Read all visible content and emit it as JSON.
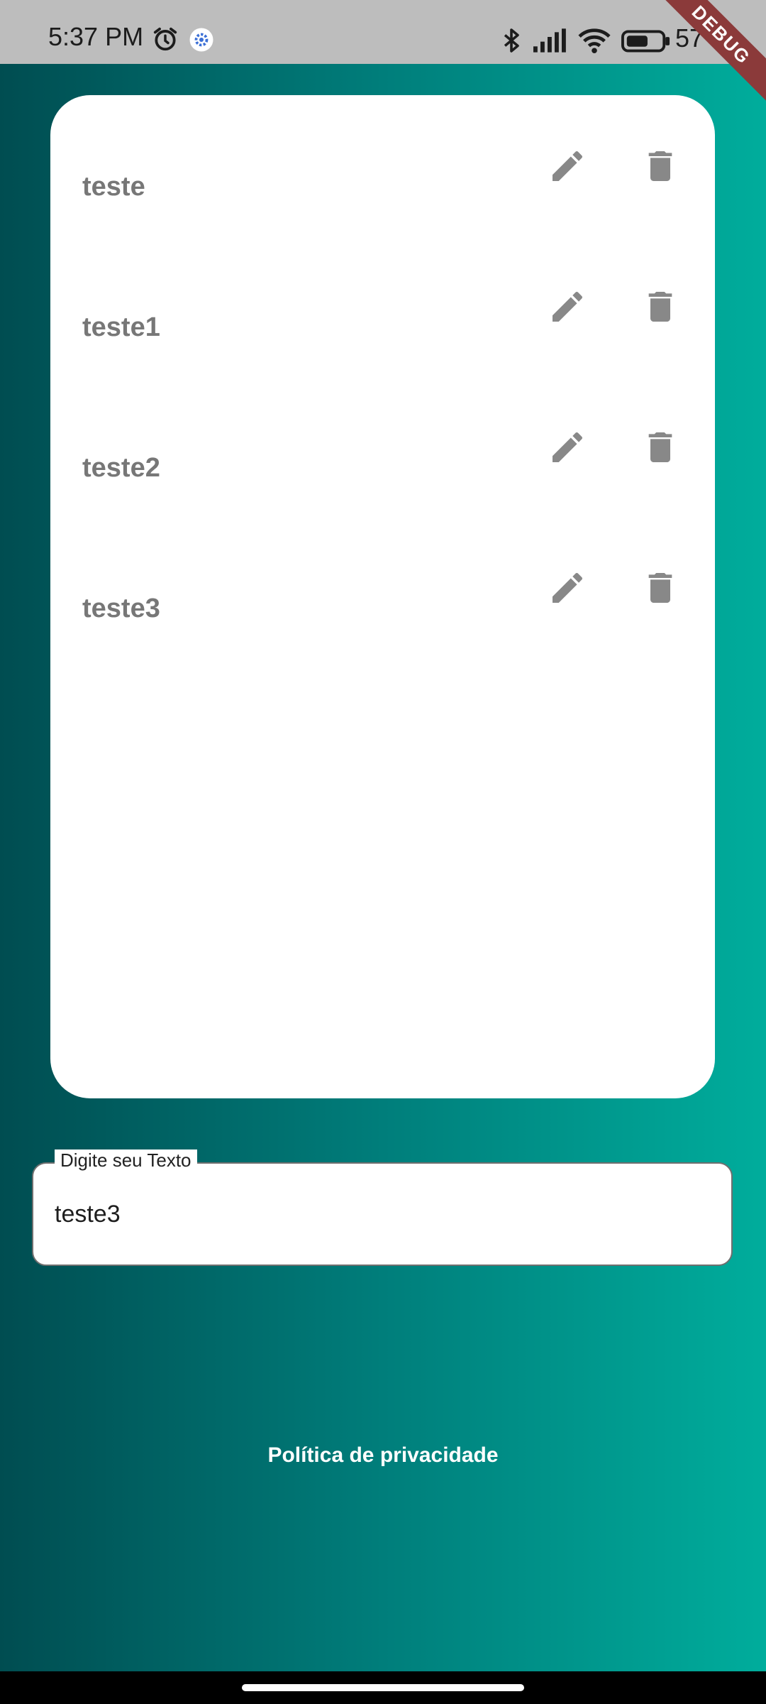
{
  "status_bar": {
    "time": "5:37 PM",
    "battery_text": "57",
    "icons": [
      "alarm-icon",
      "settings-notification-icon",
      "bluetooth-icon",
      "signal-icon",
      "wifi-icon",
      "battery-icon"
    ]
  },
  "debug_banner": "DEBUG",
  "list": {
    "items": [
      {
        "label": "teste",
        "edit_icon": "pencil-icon",
        "delete_icon": "trash-icon"
      },
      {
        "label": "teste1",
        "edit_icon": "pencil-icon",
        "delete_icon": "trash-icon"
      },
      {
        "label": "teste2",
        "edit_icon": "pencil-icon",
        "delete_icon": "trash-icon"
      },
      {
        "label": "teste3",
        "edit_icon": "pencil-icon",
        "delete_icon": "trash-icon"
      }
    ]
  },
  "input": {
    "label": "Digite seu Texto",
    "value": "teste3"
  },
  "footer": {
    "privacy_link": "Política de privacidade"
  },
  "colors": {
    "gradient_start": "#004d51",
    "gradient_end": "#00ad9c",
    "icon_gray": "#888888",
    "item_text": "#777777",
    "debug_ribbon": "#8b3a3a"
  }
}
